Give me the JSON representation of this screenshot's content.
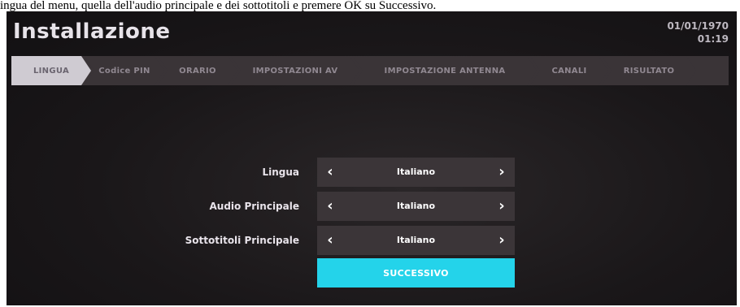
{
  "caption": "ingua del menu, quella dell'audio principale e dei sottotitoli e premere OK su Successivo.",
  "header": {
    "title": "Installazione",
    "date": "01/01/1970",
    "time": "01:19"
  },
  "steps": [
    {
      "label": "LINGUA",
      "active": true
    },
    {
      "label": "Codice PIN",
      "active": false
    },
    {
      "label": "ORARIO",
      "active": false
    },
    {
      "label": "IMPOSTAZIONI AV",
      "active": false
    },
    {
      "label": "IMPOSTAZIONE ANTENNA",
      "active": false
    },
    {
      "label": "CANALI",
      "active": false
    },
    {
      "label": "RISULTATO",
      "active": false
    }
  ],
  "form": {
    "rows": [
      {
        "label": "Lingua",
        "value": "Italiano"
      },
      {
        "label": "Audio Principale",
        "value": "Italiano"
      },
      {
        "label": "Sottotitoli Principale",
        "value": "Italiano"
      }
    ],
    "next_label": "SUCCESSIVO"
  },
  "colors": {
    "accent": "#24d3ea",
    "active_step": "#cfcbd2"
  }
}
